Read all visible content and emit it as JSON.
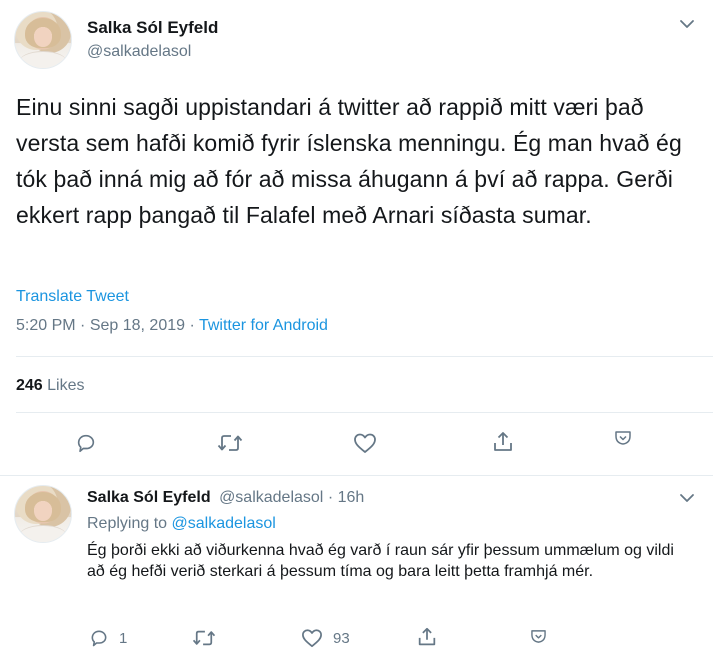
{
  "main_tweet": {
    "author": {
      "display_name": "Salka Sól Eyfeld",
      "handle": "@salkadelasol"
    },
    "text": "Einu sinni sagði uppistandari á twitter að rappið mitt væri það versta sem hafði komið fyrir íslenska menningu. Ég man hvað ég tók það inná mig að fór að missa áhugann á því að rappa. Gerði ekkert rapp þangað til Falafel með Arnari síðasta sumar.",
    "translate_label": "Translate Tweet",
    "time": "5:20 PM",
    "date": "Sep 18, 2019",
    "separator": "·",
    "source": "Twitter for Android",
    "likes": {
      "count": "246",
      "label": "Likes"
    }
  },
  "reply_tweet": {
    "author": {
      "display_name": "Salka Sól Eyfeld",
      "handle": "@salkadelasol"
    },
    "separator": "·",
    "age": "16h",
    "replying_prefix": "Replying to",
    "replying_to": "@salkadelasol",
    "text": "Ég þorði ekki að viðurkenna hvað ég varð í raun sár yfir þessum ummælum og vildi að ég hefði verið sterkari á þessum tíma og bara leitt þetta framhjá mér.",
    "reply_count": "1",
    "like_count": "93"
  },
  "icons": {
    "reply": "speech-bubble-icon",
    "retweet": "retweet-arrows-icon",
    "like": "heart-icon",
    "share": "share-upload-icon",
    "more": "chevron-down-icon",
    "bookmark": "bookmark-chevron-icon"
  },
  "colors": {
    "text": "#14171a",
    "secondary": "#657786",
    "link": "#1b95e0",
    "border": "#e6ecf0"
  }
}
